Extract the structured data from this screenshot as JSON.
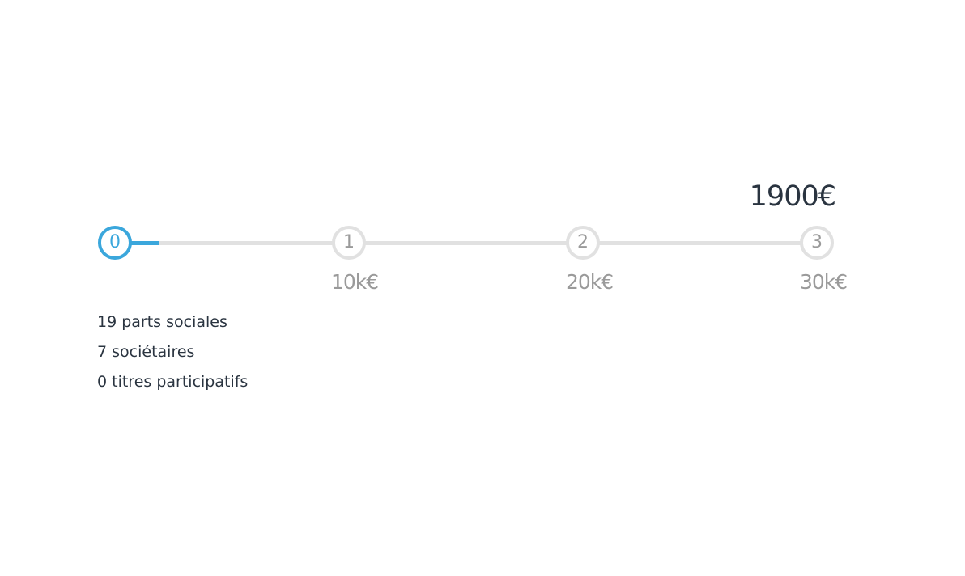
{
  "total_amount": "1900€",
  "progress": {
    "fraction_to_next_step": 0.19
  },
  "steps": [
    {
      "number": "0",
      "amount": ""
    },
    {
      "number": "1",
      "amount": "10k€"
    },
    {
      "number": "2",
      "amount": "20k€"
    },
    {
      "number": "3",
      "amount": "30k€"
    }
  ],
  "stats": [
    "19 parts sociales",
    "7 sociétaires",
    "0 titres participatifs"
  ],
  "colors": {
    "accent": "#3ba7dc",
    "inactive": "#e1e1e1",
    "muted_text": "#9a9a9a",
    "text": "#2a3440"
  }
}
